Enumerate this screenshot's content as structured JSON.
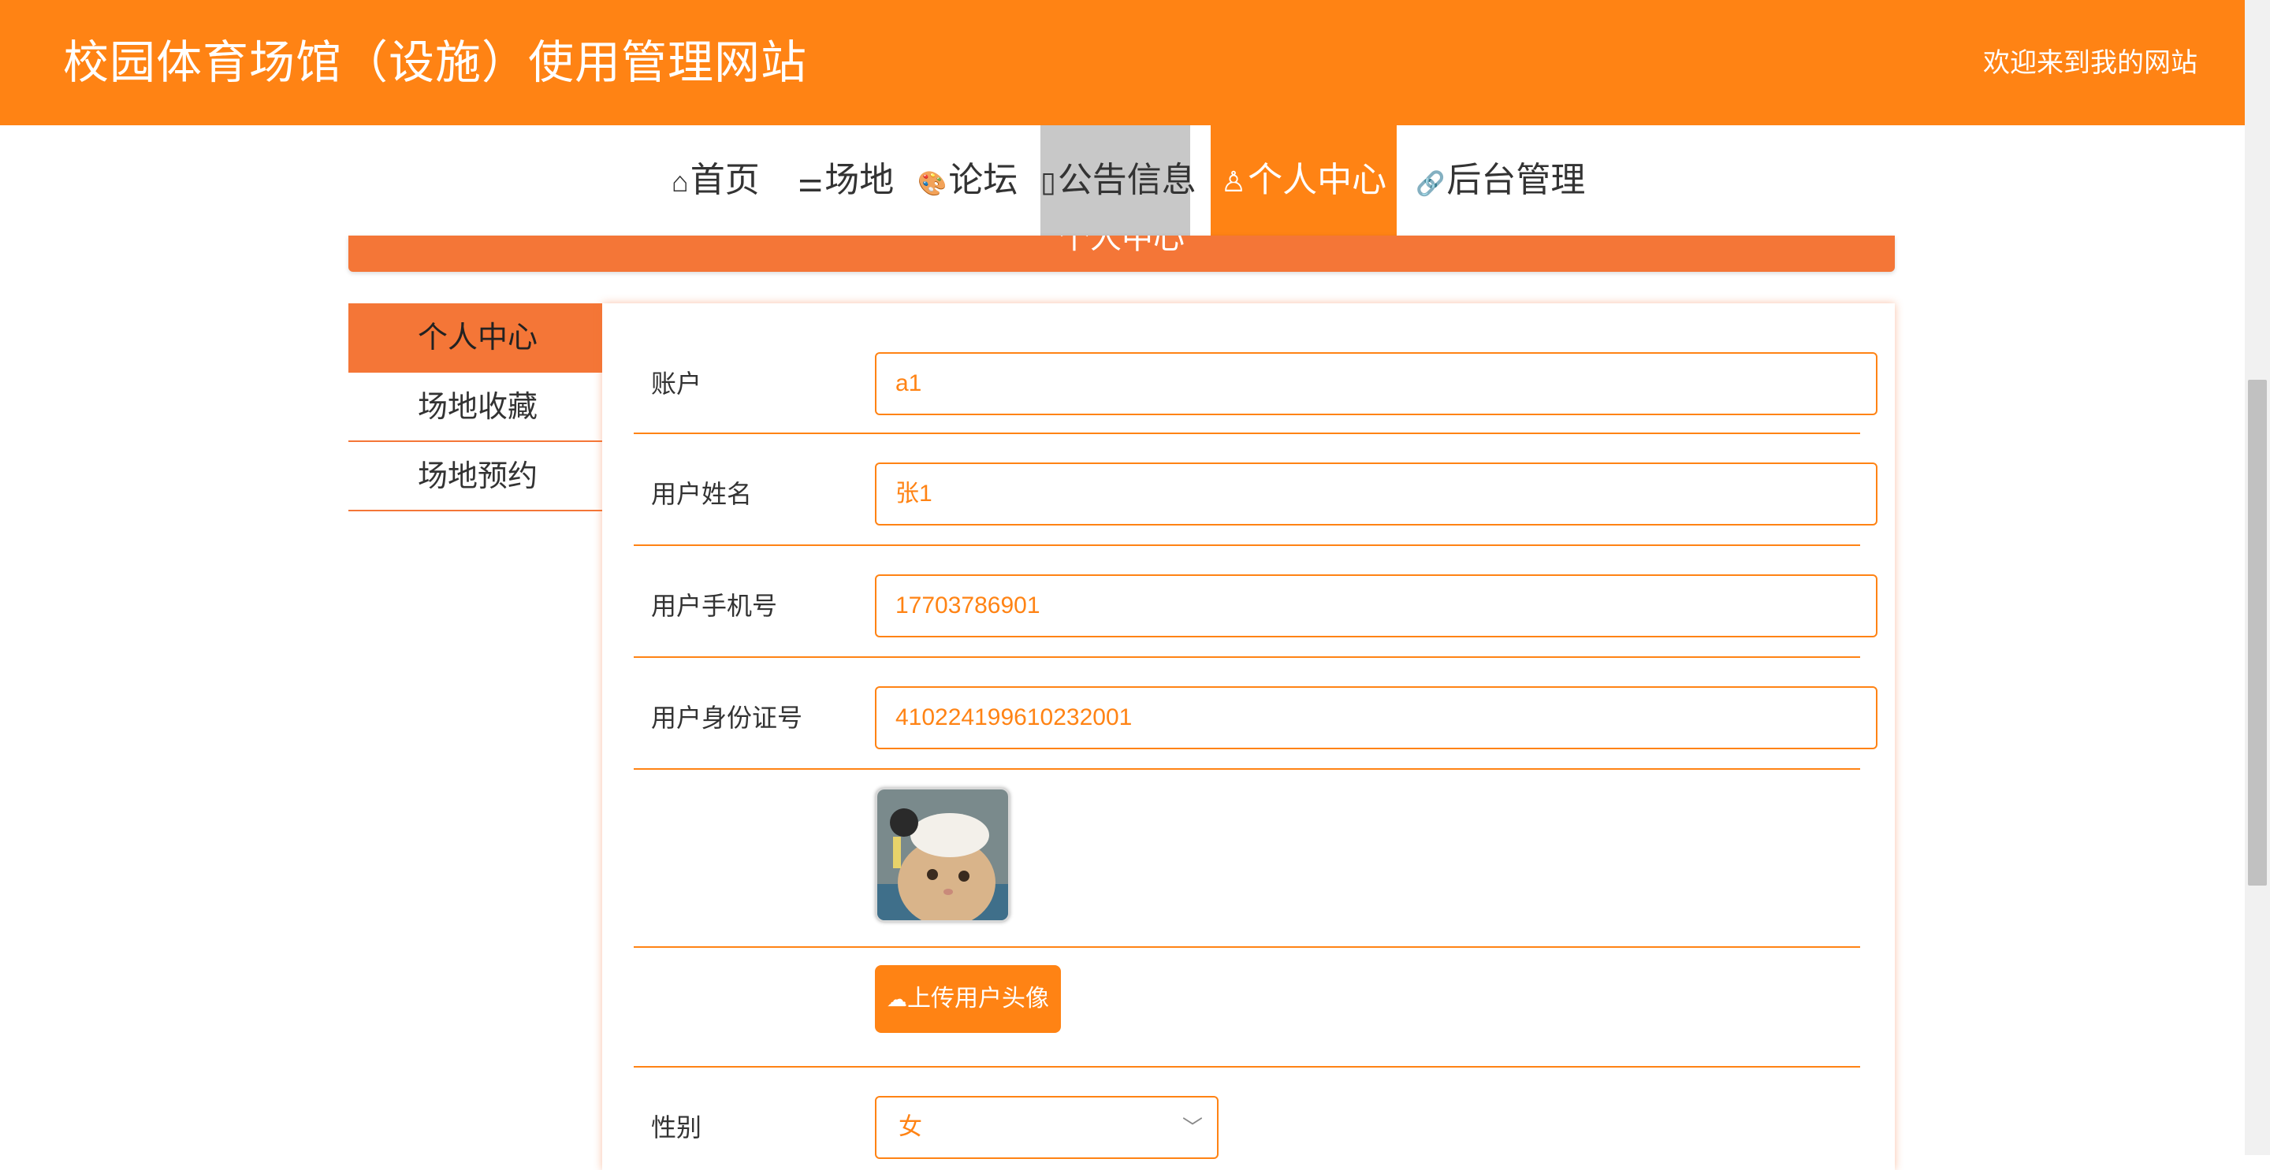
{
  "header": {
    "site_title": "校园体育场馆（设施）使用管理网站",
    "welcome": "欢迎来到我的网站"
  },
  "nav": {
    "items": [
      {
        "label": "首页",
        "icon": "home-icon",
        "glyph": "⌂"
      },
      {
        "label": "场地",
        "icon": "sliders-icon",
        "glyph": "⚌"
      },
      {
        "label": "论坛",
        "icon": "palette-icon",
        "glyph": "🎨"
      },
      {
        "label": "公告信息",
        "icon": "document-icon",
        "glyph": "▯"
      },
      {
        "label": "个人中心",
        "icon": "user-icon",
        "glyph": "♙"
      },
      {
        "label": "后台管理",
        "icon": "link-icon",
        "glyph": "🔗"
      }
    ]
  },
  "banner": {
    "title": "个人中心"
  },
  "sidebar": {
    "items": [
      {
        "label": "个人中心",
        "active": true
      },
      {
        "label": "场地收藏",
        "active": false
      },
      {
        "label": "场地预约",
        "active": false
      }
    ]
  },
  "form": {
    "account": {
      "label": "账户",
      "value": "a1"
    },
    "name": {
      "label": "用户姓名",
      "value": "张1"
    },
    "phone": {
      "label": "用户手机号",
      "value": "17703786901"
    },
    "idcard": {
      "label": "用户身份证号",
      "value": "410224199610232001"
    },
    "upload_label": "上传用户头像",
    "gender": {
      "label": "性别",
      "value": "女"
    }
  },
  "colors": {
    "brand": "#ff8314",
    "banner": "#f47637"
  }
}
